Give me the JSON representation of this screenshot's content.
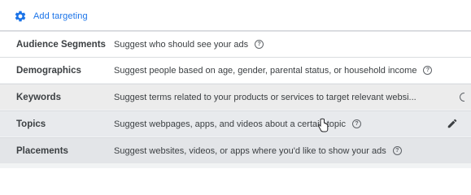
{
  "header": {
    "add_targeting_label": "Add targeting",
    "icon": "gear-icon"
  },
  "rows": [
    {
      "name": "Audience Segments",
      "description": "Suggest who should see your ads"
    },
    {
      "name": "Demographics",
      "description": "Suggest people based on age, gender, parental status, or household income"
    },
    {
      "name": "Keywords",
      "description": "Suggest terms related to your products or services to target relevant websi..."
    },
    {
      "name": "Topics",
      "description": "Suggest webpages, apps, and videos about a certain topic"
    },
    {
      "name": "Placements",
      "description": "Suggest websites, videos, or apps where you'd like to show your ads"
    }
  ],
  "help_glyph": "?",
  "colors": {
    "link": "#1a73e8",
    "text": "#3c4043",
    "divider": "#dadce0"
  }
}
